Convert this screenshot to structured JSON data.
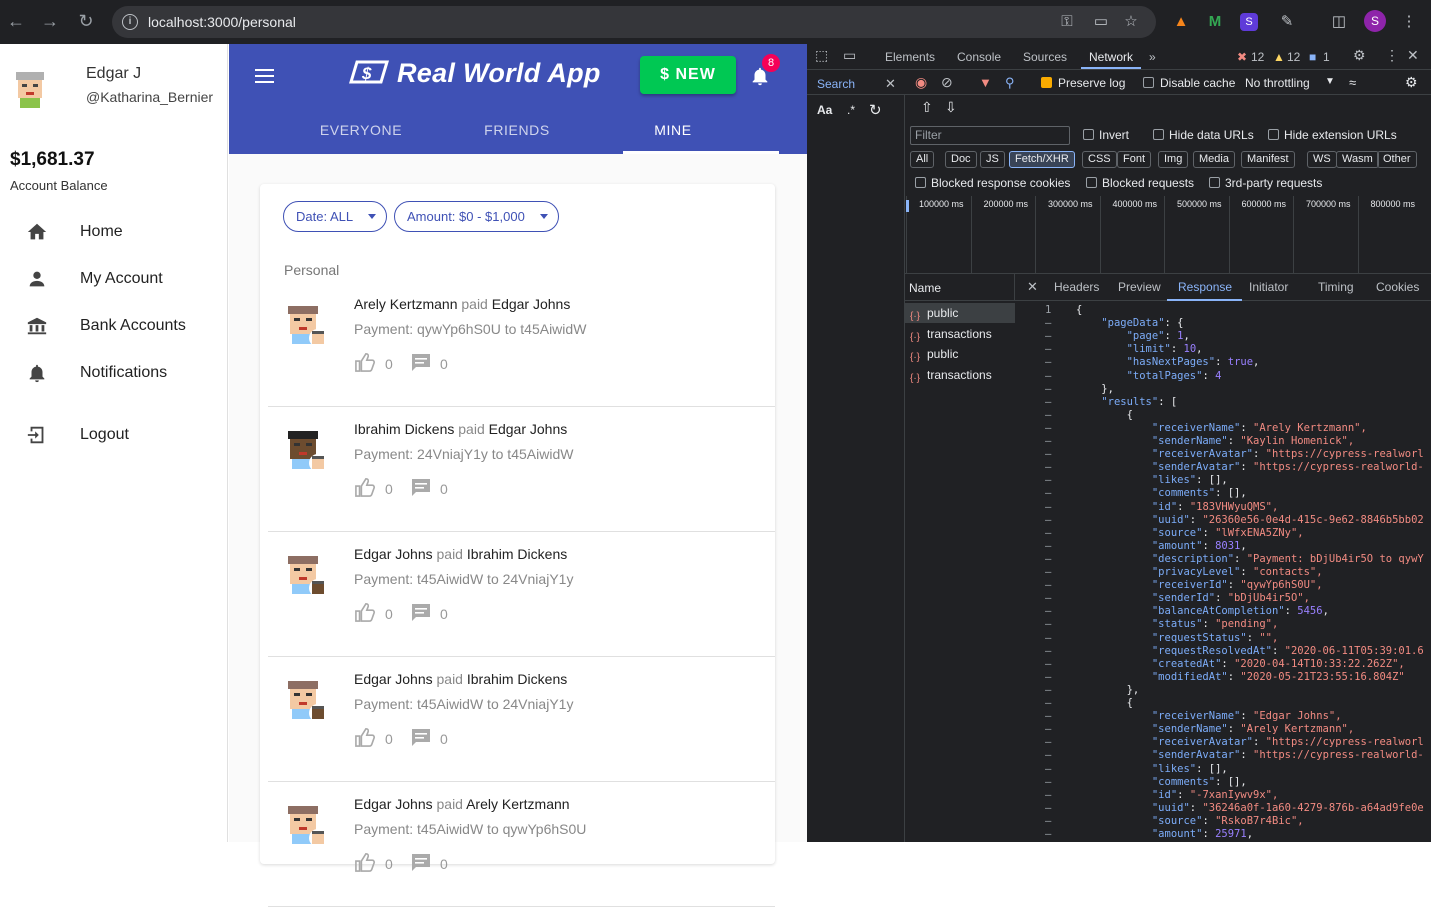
{
  "browser": {
    "url": "localhost:3000/personal"
  },
  "sidebar": {
    "user_name": "Edgar J",
    "user_handle": "@Katharina_Bernier",
    "balance": "$1,681.37",
    "balance_label": "Account Balance",
    "items": [
      {
        "label": "Home",
        "icon": "home-icon"
      },
      {
        "label": "My Account",
        "icon": "person-icon"
      },
      {
        "label": "Bank Accounts",
        "icon": "bank-icon"
      },
      {
        "label": "Notifications",
        "icon": "bell-icon"
      },
      {
        "label": "Logout",
        "icon": "logout-icon"
      }
    ]
  },
  "header": {
    "title": "Real World App",
    "new_button": "$ NEW",
    "notification_count": "8",
    "tabs": [
      "EVERYONE",
      "FRIENDS",
      "MINE"
    ],
    "active_tab": "MINE"
  },
  "filters": {
    "date": "Date: ALL",
    "amount": "Amount: $0 - $1,000"
  },
  "section_label": "Personal",
  "transactions": [
    {
      "sender": "Arely Kertzmann",
      "verb": "paid",
      "receiver": "Edgar Johns",
      "description": "Payment: qywYp6hS0U to t45AiwidW",
      "likes": "0",
      "comments": "0"
    },
    {
      "sender": "Ibrahim Dickens",
      "verb": "paid",
      "receiver": "Edgar Johns",
      "description": "Payment: 24VniajY1y to t45AiwidW",
      "likes": "0",
      "comments": "0"
    },
    {
      "sender": "Edgar Johns",
      "verb": "paid",
      "receiver": "Ibrahim Dickens",
      "description": "Payment: t45AiwidW to 24VniajY1y",
      "likes": "0",
      "comments": "0"
    },
    {
      "sender": "Edgar Johns",
      "verb": "paid",
      "receiver": "Ibrahim Dickens",
      "description": "Payment: t45AiwidW to 24VniajY1y",
      "likes": "0",
      "comments": "0"
    },
    {
      "sender": "Edgar Johns",
      "verb": "paid",
      "receiver": "Arely Kertzmann",
      "description": "Payment: t45AiwidW to qywYp6hS0U",
      "likes": "0",
      "comments": "0"
    }
  ],
  "devtools": {
    "tabs": [
      "Elements",
      "Console",
      "Sources",
      "Network"
    ],
    "active_tab": "Network",
    "errors": "12",
    "warnings": "12",
    "messages": "1",
    "search_label": "Search",
    "preserve_log": "Preserve log",
    "disable_cache": "Disable cache",
    "throttling": "No throttling",
    "filter_placeholder": "Filter",
    "invert": "Invert",
    "hide_data_urls": "Hide data URLs",
    "hide_ext_urls": "Hide extension URLs",
    "types": [
      "All",
      "Doc",
      "JS",
      "Fetch/XHR",
      "CSS",
      "Font",
      "Img",
      "Media",
      "Manifest",
      "WS",
      "Wasm",
      "Other"
    ],
    "active_type": "Fetch/XHR",
    "blocked_cookies": "Blocked response cookies",
    "blocked_requests": "Blocked requests",
    "third_party": "3rd-party requests",
    "timeline": [
      "100000 ms",
      "200000 ms",
      "300000 ms",
      "400000 ms",
      "500000 ms",
      "600000 ms",
      "700000 ms",
      "800000 ms"
    ],
    "name_header": "Name",
    "requests": [
      "public",
      "transactions",
      "public",
      "transactions"
    ],
    "response_tabs": [
      "Headers",
      "Preview",
      "Response",
      "Initiator",
      "Timing",
      "Cookies"
    ],
    "active_response_tab": "Response",
    "response_lines": [
      "{",
      "    \"pageData\": {",
      "        \"page\": 1,",
      "        \"limit\": 10,",
      "        \"hasNextPages\": true,",
      "        \"totalPages\": 4",
      "    },",
      "    \"results\": [",
      "        {",
      "            \"receiverName\": \"Arely Kertzmann\",",
      "            \"senderName\": \"Kaylin Homenick\",",
      "            \"receiverAvatar\": \"https://cypress-realworl",
      "            \"senderAvatar\": \"https://cypress-realworld-",
      "            \"likes\": [],",
      "            \"comments\": [],",
      "            \"id\": \"183VHWyuQMS\",",
      "            \"uuid\": \"26360e56-0e4d-415c-9e62-8846b5bb02",
      "            \"source\": \"lWfxENA5ZNy\",",
      "            \"amount\": 8031,",
      "            \"description\": \"Payment: bDjUb4ir5O to qywY",
      "            \"privacyLevel\": \"contacts\",",
      "            \"receiverId\": \"qywYp6hS0U\",",
      "            \"senderId\": \"bDjUb4ir5O\",",
      "            \"balanceAtCompletion\": 5456,",
      "            \"status\": \"pending\",",
      "            \"requestStatus\": \"\",",
      "            \"requestResolvedAt\": \"2020-06-11T05:39:01.6",
      "            \"createdAt\": \"2020-04-14T10:33:22.262Z\",",
      "            \"modifiedAt\": \"2020-05-21T23:55:16.804Z\"",
      "        },",
      "        {",
      "            \"receiverName\": \"Edgar Johns\",",
      "            \"senderName\": \"Arely Kertzmann\",",
      "            \"receiverAvatar\": \"https://cypress-realworl",
      "            \"senderAvatar\": \"https://cypress-realworld-",
      "            \"likes\": [],",
      "            \"comments\": [],",
      "            \"id\": \"-7xanIywv9x\",",
      "            \"uuid\": \"36246a0f-1a60-4279-876b-a64ad9fe0e",
      "            \"source\": \"RskoB7r4Bic\",",
      "            \"amount\": 25971,"
    ],
    "first_line_no": "1"
  }
}
